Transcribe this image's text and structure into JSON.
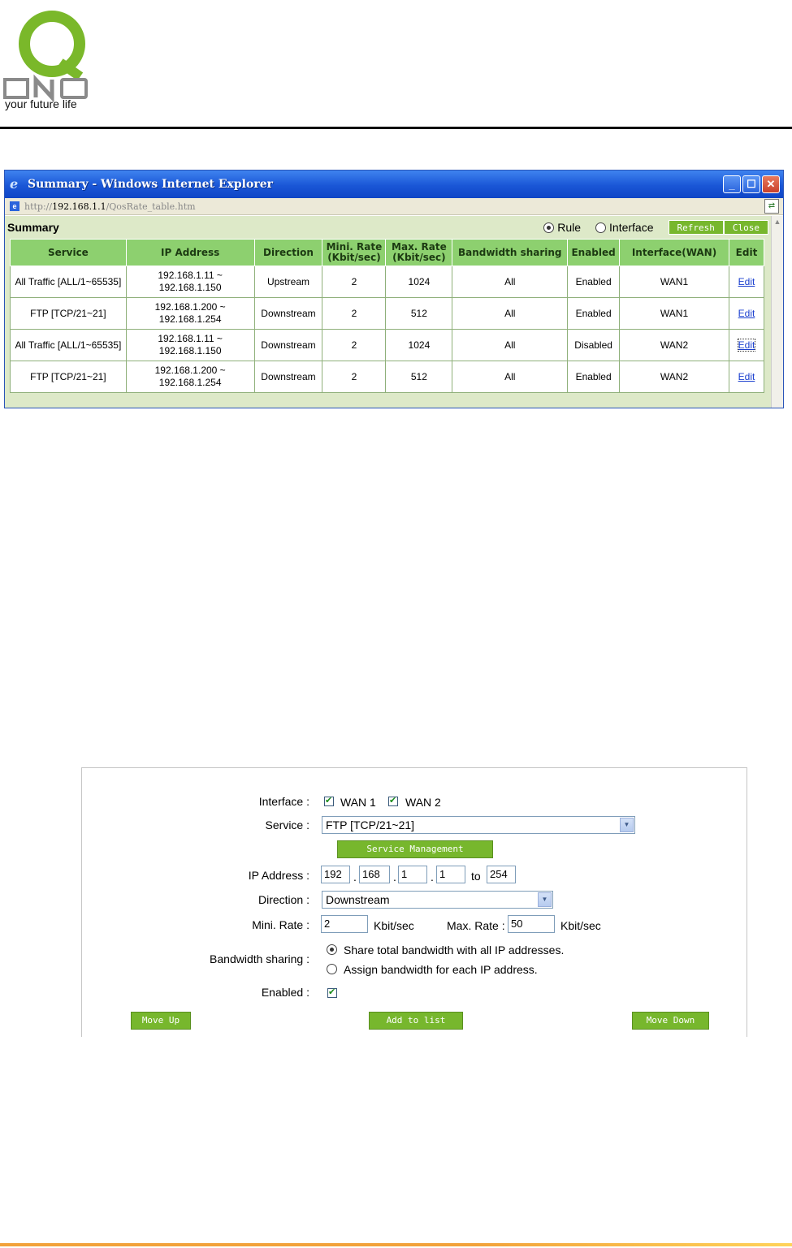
{
  "brand": {
    "logo_letters": "QNO",
    "tagline": "your future life",
    "primary_color": "#7ab82a"
  },
  "window": {
    "title": "Summary - Windows Internet Explorer",
    "url_prefix": "http://",
    "url_host": "192.168.1.1",
    "url_path": "/QosRate_table.htm"
  },
  "summary": {
    "title": "Summary",
    "view_options": [
      {
        "label": "Rule",
        "selected": true
      },
      {
        "label": "Interface",
        "selected": false
      }
    ],
    "refresh_label": "Refresh",
    "close_label": "Close",
    "headers": [
      "Service",
      "IP Address",
      "Direction",
      "Mini. Rate (Kbit/sec)",
      "Max. Rate (Kbit/sec)",
      "Bandwidth sharing",
      "Enabled",
      "Interface(WAN)",
      "Edit"
    ],
    "rows": [
      {
        "service": "All Traffic [ALL/1~65535]",
        "ip": "192.168.1.11 ~ 192.168.1.150",
        "direction": "Upstream",
        "min": "2",
        "max": "1024",
        "sharing": "All",
        "enabled": "Enabled",
        "wan": "WAN1",
        "edit": "Edit"
      },
      {
        "service": "FTP [TCP/21~21]",
        "ip": "192.168.1.200 ~ 192.168.1.254",
        "direction": "Downstream",
        "min": "2",
        "max": "512",
        "sharing": "All",
        "enabled": "Enabled",
        "wan": "WAN1",
        "edit": "Edit"
      },
      {
        "service": "All Traffic [ALL/1~65535]",
        "ip": "192.168.1.11 ~ 192.168.1.150",
        "direction": "Downstream",
        "min": "2",
        "max": "1024",
        "sharing": "All",
        "enabled": "Disabled",
        "wan": "WAN2",
        "edit": "Edit"
      },
      {
        "service": "FTP [TCP/21~21]",
        "ip": "192.168.1.200 ~ 192.168.1.254",
        "direction": "Downstream",
        "min": "2",
        "max": "512",
        "sharing": "All",
        "enabled": "Enabled",
        "wan": "WAN2",
        "edit": "Edit"
      }
    ]
  },
  "form": {
    "interface_label": "Interface :",
    "wan1_label": "WAN 1",
    "wan2_label": "WAN 2",
    "service_label": "Service :",
    "service_value": "FTP [TCP/21~21]",
    "service_mgmt_label": "Service Management",
    "ip_label": "IP Address :",
    "ip_octets": [
      "192",
      "168",
      "1",
      "1"
    ],
    "ip_dot": ".",
    "ip_to_label": "to",
    "ip_to_value": "254",
    "direction_label": "Direction :",
    "direction_value": "Downstream",
    "min_label": "Mini. Rate :",
    "min_value": "2",
    "unit": "Kbit/sec",
    "max_label": "Max. Rate :",
    "max_value": "50",
    "sharing_label": "Bandwidth sharing :",
    "sharing_opt1": "Share total bandwidth with all IP addresses.",
    "sharing_opt2": "Assign bandwidth for each IP address.",
    "enabled_label": "Enabled  :",
    "move_up": "Move Up",
    "add_to_list": "Add to list",
    "move_down": "Move Down"
  }
}
